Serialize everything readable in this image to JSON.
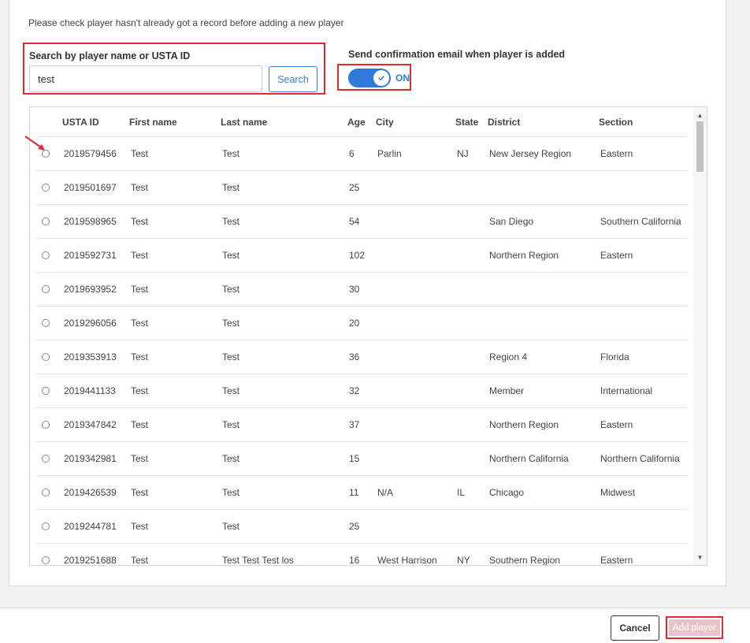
{
  "notice": "Please check player hasn't already got a record before adding a new player",
  "search": {
    "label": "Search by player name or USTA ID",
    "value": "test",
    "button": "Search"
  },
  "email_toggle": {
    "label": "Send confirmation email when player is added",
    "state": "ON"
  },
  "table": {
    "headers": {
      "usta_id": "USTA ID",
      "first_name": "First name",
      "last_name": "Last name",
      "age": "Age",
      "city": "City",
      "state": "State",
      "district": "District",
      "section": "Section"
    },
    "rows": [
      {
        "usta_id": "2019579456",
        "first": "Test",
        "last": "Test",
        "age": "6",
        "city": "Parlin",
        "state": "NJ",
        "district": "New Jersey Region",
        "section": "Eastern"
      },
      {
        "usta_id": "2019501697",
        "first": "Test",
        "last": "Test",
        "age": "25",
        "city": "",
        "state": "",
        "district": "",
        "section": ""
      },
      {
        "usta_id": "2019598965",
        "first": "Test",
        "last": "Test",
        "age": "54",
        "city": "",
        "state": "",
        "district": "San Diego",
        "section": "Southern California"
      },
      {
        "usta_id": "2019592731",
        "first": "Test",
        "last": "Test",
        "age": "102",
        "city": "",
        "state": "",
        "district": "Northern Region",
        "section": "Eastern"
      },
      {
        "usta_id": "2019693952",
        "first": "Test",
        "last": "Test",
        "age": "30",
        "city": "",
        "state": "",
        "district": "",
        "section": ""
      },
      {
        "usta_id": "2019296056",
        "first": "Test",
        "last": "Test",
        "age": "20",
        "city": "",
        "state": "",
        "district": "",
        "section": ""
      },
      {
        "usta_id": "2019353913",
        "first": "Test",
        "last": "Test",
        "age": "36",
        "city": "",
        "state": "",
        "district": "Region 4",
        "section": "Florida"
      },
      {
        "usta_id": "2019441133",
        "first": "Test",
        "last": "Test",
        "age": "32",
        "city": "",
        "state": "",
        "district": "Member",
        "section": "International"
      },
      {
        "usta_id": "2019347842",
        "first": "Test",
        "last": "Test",
        "age": "37",
        "city": "",
        "state": "",
        "district": "Northern Region",
        "section": "Eastern"
      },
      {
        "usta_id": "2019342981",
        "first": "Test",
        "last": "Test",
        "age": "15",
        "city": "",
        "state": "",
        "district": "Northern California",
        "section": "Northern California"
      },
      {
        "usta_id": "2019426539",
        "first": "Test",
        "last": "Test",
        "age": "11",
        "city": "N/A",
        "state": "IL",
        "district": "Chicago",
        "section": "Midwest"
      },
      {
        "usta_id": "2019244781",
        "first": "Test",
        "last": "Test",
        "age": "25",
        "city": "",
        "state": "",
        "district": "",
        "section": ""
      },
      {
        "usta_id": "2019251688",
        "first": "Test",
        "last": "Test Test Test los",
        "age": "16",
        "city": "West Harrison",
        "state": "NY",
        "district": "Southern Region",
        "section": "Eastern"
      }
    ]
  },
  "footer": {
    "cancel": "Cancel",
    "add": "Add player"
  },
  "colors": {
    "accent": "#2f7bd9",
    "highlight": "#e02b2b",
    "disabled_button": "#e9c3c8"
  }
}
